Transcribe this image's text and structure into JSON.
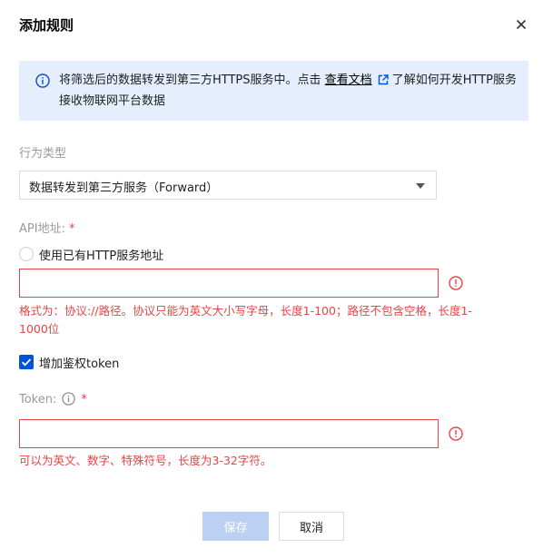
{
  "dialog": {
    "title": "添加规则"
  },
  "alert": {
    "text_before": "将筛选后的数据转发到第三方HTTPS服务中。点击",
    "link": "查看文档",
    "text_after": "了解如何开发HTTP服务接收物联网平台数据",
    "icon": "info-circle-icon"
  },
  "action_type": {
    "label": "行为类型",
    "selected": "数据转发到第三方服务（Forward）"
  },
  "api": {
    "label": "API地址:",
    "required_mark": "*",
    "radio_label": "使用已有HTTP服务地址",
    "value": "",
    "error": "格式为：协议://路径。协议只能为英文大小写字母，长度1-100；路径不包含空格，长度1-1000位"
  },
  "auth": {
    "checkbox_label": "增加鉴权token",
    "checked": true
  },
  "token": {
    "label": "Token:",
    "required_mark": "*",
    "value": "",
    "error": "可以为英文、数字、特殊符号，长度为3-32字符。"
  },
  "buttons": {
    "save": "保存",
    "cancel": "取消"
  },
  "colors": {
    "primary": "#0052d9",
    "error": "#e54545",
    "alert_bg": "#e5eefc",
    "disabled_primary": "#bcd0f3"
  }
}
